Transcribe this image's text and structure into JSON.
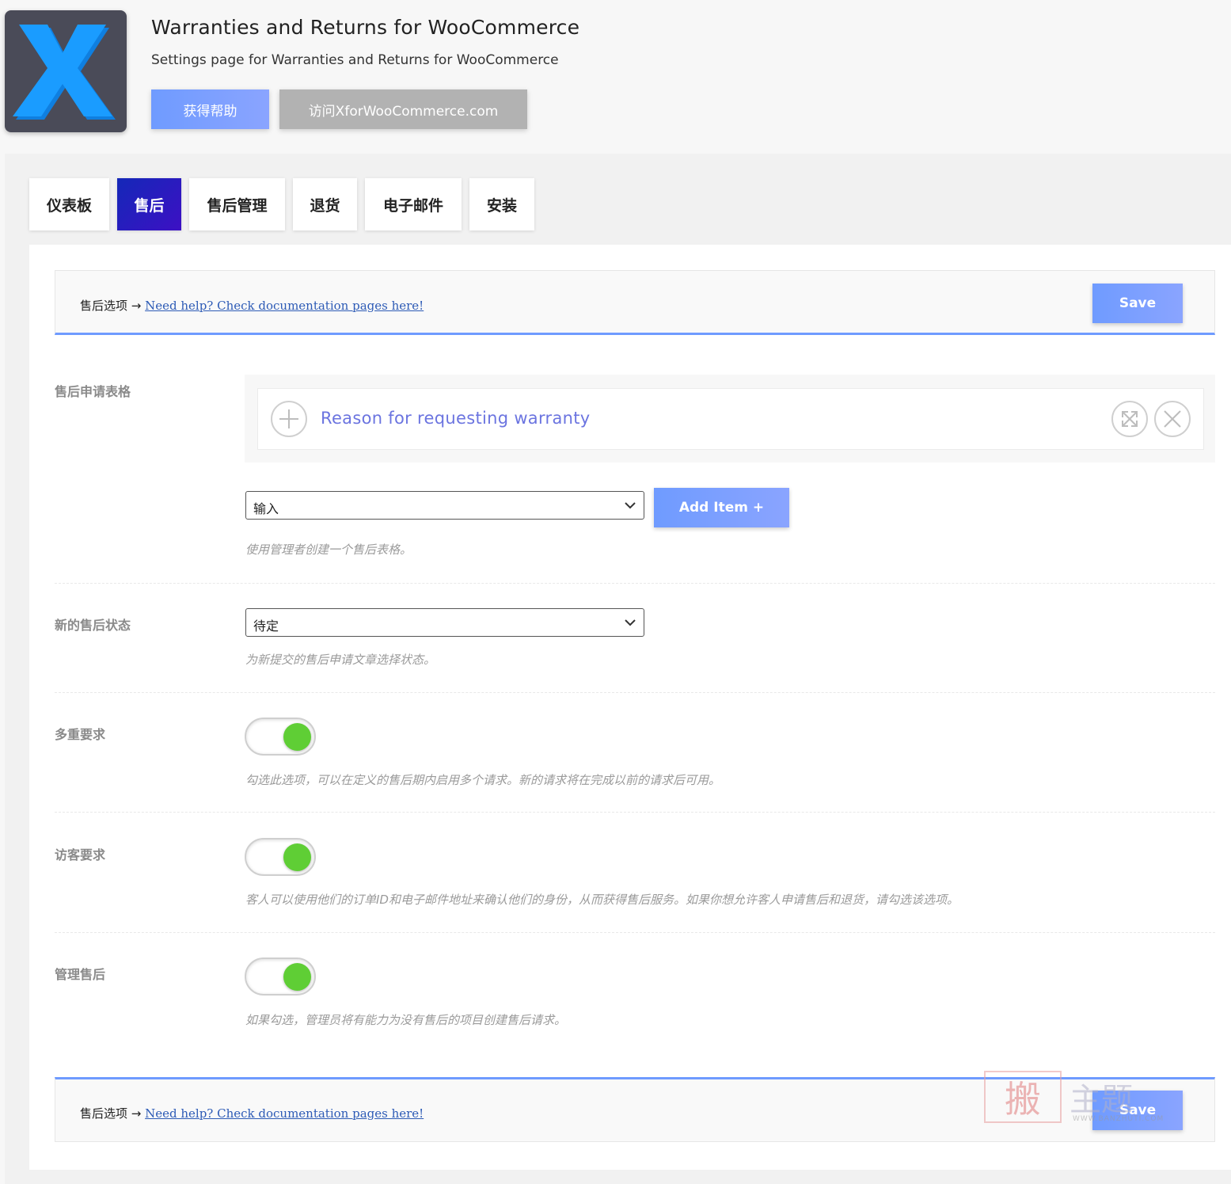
{
  "header": {
    "title": "Warranties and Returns for WooCommerce",
    "subtitle": "Settings page for Warranties and Returns for WooCommerce",
    "help_button": "获得帮助",
    "visit_button": "访问XforWooCommerce.com",
    "logo_letter": "X",
    "logo_color": "#1a9cff"
  },
  "tabs": [
    {
      "label": "仪表板",
      "active": false
    },
    {
      "label": "售后",
      "active": true
    },
    {
      "label": "售后管理",
      "active": false
    },
    {
      "label": "退货",
      "active": false
    },
    {
      "label": "电子邮件",
      "active": false
    },
    {
      "label": "安装",
      "active": false
    }
  ],
  "section_bar": {
    "prefix": "售后选项 → ",
    "link": "Need help? Check documentation pages here!",
    "save": "Save"
  },
  "fields": {
    "form": {
      "label": "售后申请表格",
      "item_label": "Reason for requesting warranty",
      "select_value": "输入",
      "add_button": "Add Item +",
      "description": "使用管理者创建一个售后表格。"
    },
    "status": {
      "label": "新的售后状态",
      "select_value": "待定",
      "description": "为新提交的售后申请文章选择状态。"
    },
    "multiple": {
      "label": "多重要求",
      "enabled": true,
      "description": "勾选此选项，可以在定义的售后期内启用多个请求。新的请求将在完成以前的请求后可用。"
    },
    "guest": {
      "label": "访客要求",
      "enabled": true,
      "description": "客人可以使用他们的订单ID和电子邮件地址来确认他们的身份，从而获得售后服务。如果你想允许客人申请售后和退货，请勾选该选项。"
    },
    "admin": {
      "label": "管理售后",
      "enabled": true,
      "description": "如果勾选，管理员将有能力为没有售后的项目创建售后请求。"
    }
  },
  "watermark": {
    "stamp": "搬",
    "text": "主题",
    "url": "WWW.BANZHUTI.COM"
  },
  "colors": {
    "accent": "#6f9bff",
    "active_tab": "#1428b8",
    "toggle_on": "#5fce35",
    "item_label": "#6b74e0"
  }
}
